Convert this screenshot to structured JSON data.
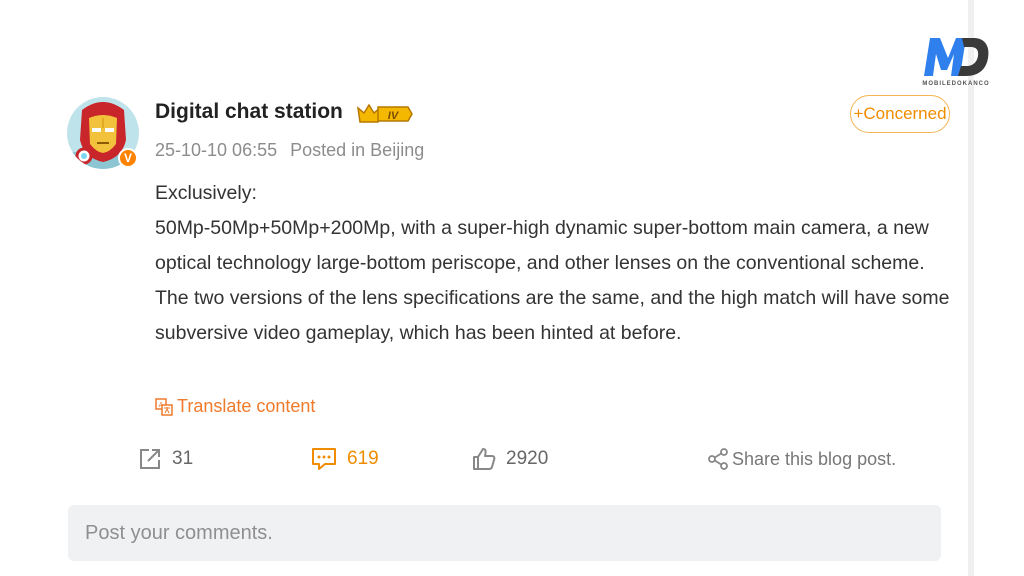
{
  "watermark": {
    "logo_text": "MD",
    "caption": "MOBILEDOKANCO"
  },
  "post": {
    "author": {
      "name": "Digital chat station",
      "level_badge": "IV",
      "verified_badge": "V"
    },
    "meta": {
      "timestamp": "25-10-10 06:55",
      "location": "Posted in Beijing"
    },
    "follow_label": "+Concerned",
    "body": {
      "line_intro": "Exclusively:",
      "paragraph": "50Mp-50Mp+50Mp+200Mp, with a super-high dynamic super-bottom main camera, a new optical technology large-bottom periscope, and other lenses on the conventional scheme. The two versions of the lens specifications are the same, and the high match will have some subversive video gameplay, which has been hinted at before."
    },
    "translate_label": "Translate content",
    "actions": {
      "forward_count": "31",
      "comment_count": "619",
      "like_count": "2920",
      "share_label": "Share this blog post."
    }
  },
  "comment_input": {
    "placeholder": "Post your comments."
  },
  "colors": {
    "accent": "#f08c00",
    "link_orange": "#ef7a2b",
    "badge_gold": "#f5b800",
    "logo_blue": "#2f80ed"
  },
  "icons": [
    "forward-icon",
    "comment-icon",
    "like-icon",
    "share-icon",
    "translate-icon",
    "crown-icon",
    "verified-icon"
  ]
}
